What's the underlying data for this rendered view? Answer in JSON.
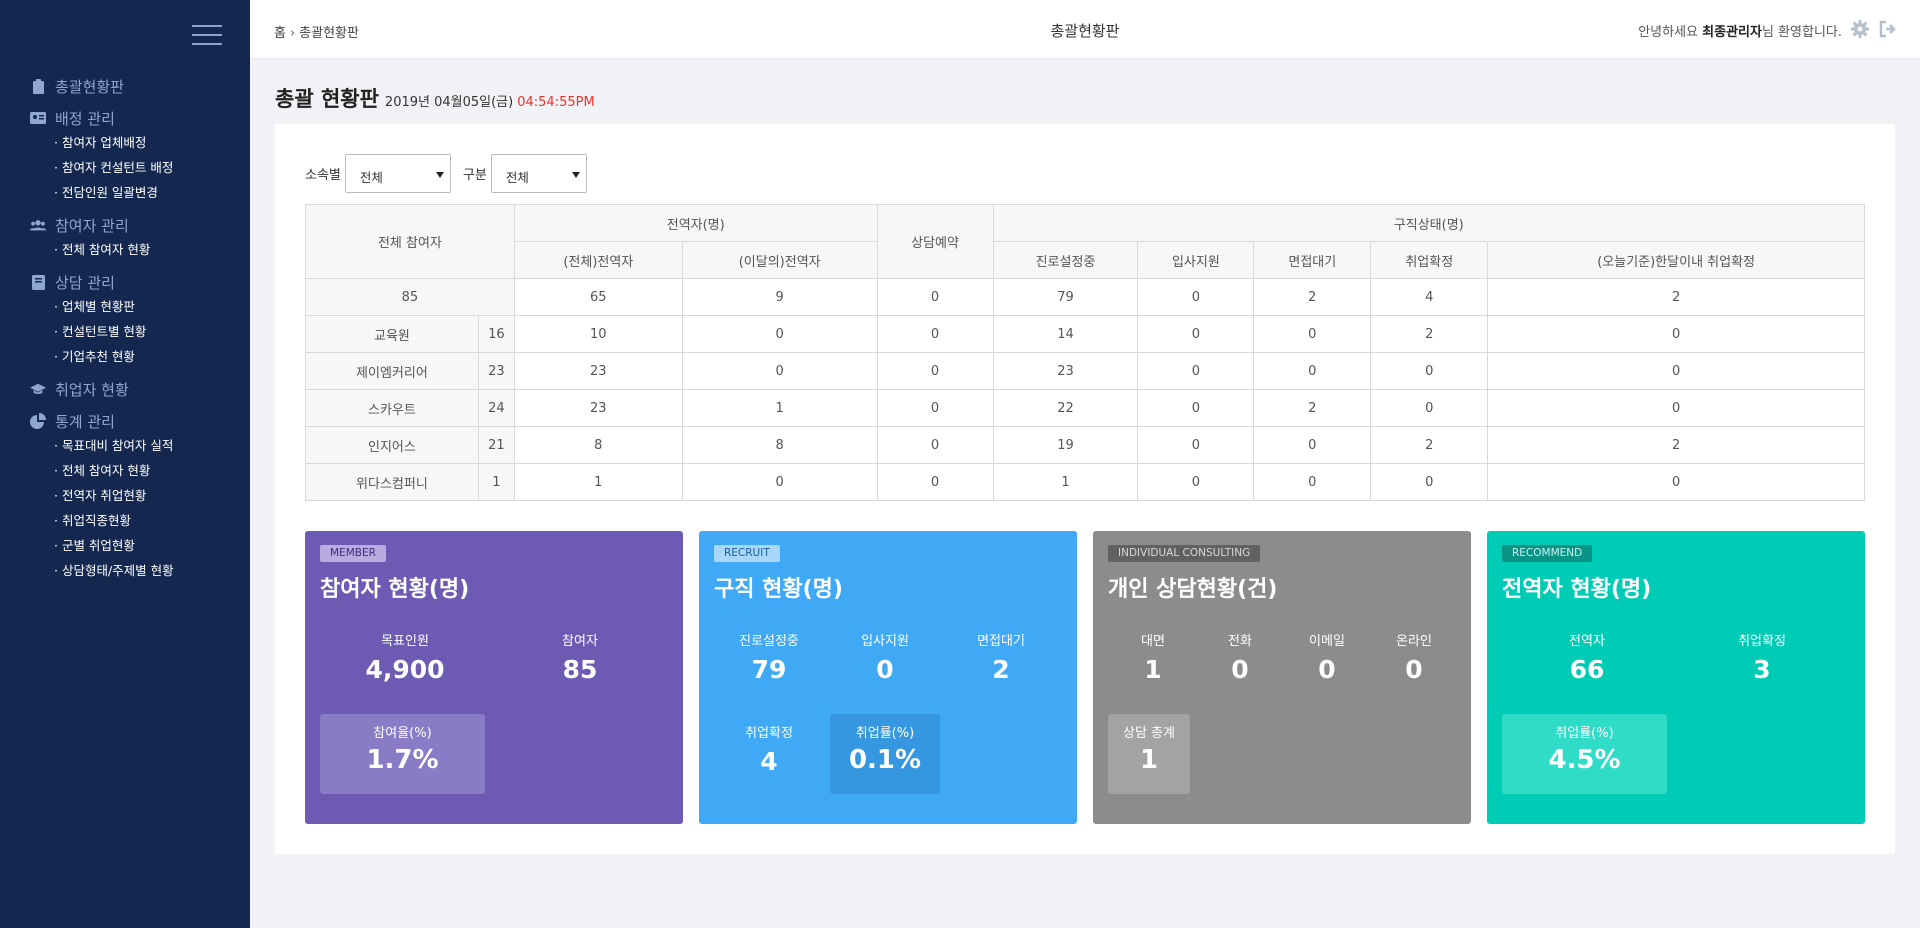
{
  "sidebar": {
    "groups": [
      {
        "label": "총괄현황판",
        "icon": "clipboard-icon",
        "items": []
      },
      {
        "label": "배정 관리",
        "icon": "id-card-icon",
        "items": [
          "· 참여자 업체배정",
          "· 참여자 컨설턴트 배정",
          "· 전담인원 일괄변경"
        ]
      },
      {
        "label": "참여자 관리",
        "icon": "users-icon",
        "items": [
          "· 전체 참여자 현황"
        ]
      },
      {
        "label": "상담 관리",
        "icon": "book-icon",
        "items": [
          "· 업체별 현황판",
          "· 컨설턴트별 현황",
          "· 기업추천 현황"
        ]
      },
      {
        "label": "취업자 현황",
        "icon": "graduation-cap-icon",
        "items": []
      },
      {
        "label": "통계 관리",
        "icon": "pie-chart-icon",
        "items": [
          "· 목표대비 참여자 실적",
          "· 전체 참여자 현황",
          "· 전역자 취업현황",
          "· 취업직종현황",
          "· 군별 취업현황",
          "· 상담형태/주제별 현황"
        ]
      }
    ]
  },
  "topbar": {
    "crumb_home": "홈",
    "crumb_sep": "›",
    "crumb_current": "총괄현황판",
    "title": "총괄현황판",
    "welcome_pre": "안녕하세요 ",
    "welcome_name": "최종관리자",
    "welcome_post": "님 환영합니다."
  },
  "page": {
    "title": "총괄 현황판",
    "date": "2019년 04월05일(금)",
    "time": "04:54:55PM"
  },
  "filters": {
    "affiliation_label": "소속별",
    "affiliation_value": "전체",
    "category_label": "구분",
    "category_value": "전체"
  },
  "table": {
    "h_total": "전체 참여자",
    "h_discharged": "전역자(명)",
    "h_consult": "상담예약",
    "h_jobstatus": "구직상태(명)",
    "sub": [
      "(전체)전역자",
      "(이달의)전역자",
      "진로설정중",
      "입사지원",
      "면접대기",
      "취업확정",
      "(오늘기준)한달이내 취업확정"
    ],
    "total_row": [
      "85",
      "65",
      "9",
      "0",
      "79",
      "0",
      "2",
      "4",
      "2"
    ],
    "rows": [
      [
        "교육원",
        "16",
        "10",
        "0",
        "0",
        "14",
        "0",
        "0",
        "2",
        "0"
      ],
      [
        "제이엠커리어",
        "23",
        "23",
        "0",
        "0",
        "23",
        "0",
        "0",
        "0",
        "0"
      ],
      [
        "스카우트",
        "24",
        "23",
        "1",
        "0",
        "22",
        "0",
        "2",
        "0",
        "0"
      ],
      [
        "인지어스",
        "21",
        "8",
        "8",
        "0",
        "19",
        "0",
        "0",
        "2",
        "2"
      ],
      [
        "위다스컴퍼니",
        "1",
        "1",
        "0",
        "0",
        "1",
        "0",
        "0",
        "0",
        "0"
      ]
    ]
  },
  "cards": {
    "member": {
      "tag": "MEMBER",
      "title": "참여자 현황(명)",
      "color": "#6d5bb3",
      "k1": "목표인원",
      "v1": "4,900",
      "k2": "참여자",
      "v2": "85",
      "bk": "참여율(%)",
      "bv": "1.7%"
    },
    "recruit": {
      "tag": "RECRUIT",
      "title": "구직 현황(명)",
      "color": "#3fa9f5",
      "k1": "진로설정중",
      "v1": "79",
      "k2": "입사지원",
      "v2": "0",
      "k3": "면접대기",
      "v3": "2",
      "k4": "취업확정",
      "v4": "4",
      "bk": "취업률(%)",
      "bv": "0.1%"
    },
    "consult": {
      "tag": "INDIVIDUAL CONSULTING",
      "title": "개인 상담현황(건)",
      "color": "#8c8c8c",
      "k1": "대면",
      "v1": "1",
      "k2": "전화",
      "v2": "0",
      "k3": "이메일",
      "v3": "0",
      "k4": "온라인",
      "v4": "0",
      "bk": "상담 총계",
      "bv": "1"
    },
    "recommend": {
      "tag": "RECOMMEND",
      "title": "전역자 현황(명)",
      "color": "#00ccb6",
      "k1": "전역자",
      "v1": "66",
      "k2": "취업확정",
      "v2": "3",
      "bk": "취업률(%)",
      "bv": "4.5%"
    }
  }
}
